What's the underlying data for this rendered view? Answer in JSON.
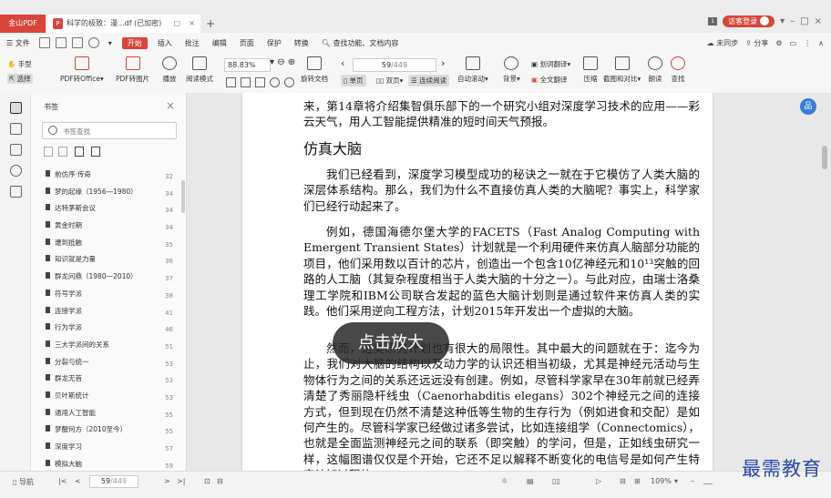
{
  "tabs": {
    "app": "金山PDF",
    "doc": "科学的极致：漫...df (已加密)",
    "new": "+"
  },
  "window": {
    "visitor": "访客登录",
    "badge": "1",
    "min": "–",
    "max": "□",
    "close": "×"
  },
  "menu": {
    "file": "文件",
    "items": [
      "开始",
      "插入",
      "批注",
      "编辑",
      "页面",
      "保护",
      "转换"
    ],
    "search": "查找功能、文档内容",
    "sync": "未同步",
    "share": "分享"
  },
  "toolbar": {
    "hand": "手型",
    "select": "选择",
    "pdf_to_office": "PDF转Office",
    "pdf_to_image": "PDF转图片",
    "play": "播放",
    "read_mode": "阅读模式",
    "zoom_value": "88.83%",
    "rotate": "旋转文档",
    "page_current": "59",
    "page_total": "/449",
    "single": "单页",
    "double": "双页",
    "continuous": "连续阅读",
    "auto_scroll": "自动滚动",
    "background": "背景",
    "translate_all": "全文翻译",
    "translate_word": "划词翻译",
    "compress": "压缩",
    "screenshot_compare": "截图和对比",
    "read_aloud": "朗读",
    "find": "查找"
  },
  "bookmarks": {
    "title": "书签",
    "search_placeholder": "书签查找",
    "items": [
      {
        "label": "前仿序·传奇",
        "page": "32"
      },
      {
        "label": "梦的起缘（1956—1980）",
        "page": "34"
      },
      {
        "label": "达特茅斯会议",
        "page": "34"
      },
      {
        "label": "黄金时期",
        "page": "34"
      },
      {
        "label": "遭到抵触",
        "page": "35"
      },
      {
        "label": "知识就是力量",
        "page": "36"
      },
      {
        "label": "群龙问鼎（1980—2010）",
        "page": "37"
      },
      {
        "label": "符号学派",
        "page": "38"
      },
      {
        "label": "连接学派",
        "page": "41"
      },
      {
        "label": "行为学派",
        "page": "46"
      },
      {
        "label": "三大学派间的关系",
        "page": "51"
      },
      {
        "label": "分裂与统一",
        "page": "53"
      },
      {
        "label": "群龙无首",
        "page": "53"
      },
      {
        "label": "贝叶斯统计",
        "page": "53"
      },
      {
        "label": "通用人工智能",
        "page": "55"
      },
      {
        "label": "梦醒何方（2010至今）",
        "page": "55"
      },
      {
        "label": "深度学习",
        "page": "57"
      },
      {
        "label": "模拟大脑",
        "page": "59"
      }
    ]
  },
  "document": {
    "para_top": "来，第14章将介绍集智俱乐部下的一个研究小组对深度学习技术的应用——彩云天气，用人工智能提供精准的短时间天气预报。",
    "heading": "仿真大脑",
    "para1": "我们已经看到，深度学习模型成功的秘诀之一就在于它模仿了人类大脑的深层体系结构。那么，我们为什么不直接仿真人类的大脑呢？事实上，科学家们已经行动起来了。",
    "para2": "例如，德国海德尔堡大学的FACETS（Fast Analog Computing with Emergent Transient States）计划就是一个利用硬件来仿真人脑部分功能的项目，他们采用数以百计的芯片，创造出一个包含10亿神经元和10¹³突触的回路的人工脑（其复杂程度相当于人类大脑的十分之一）。与此对应，由瑞士洛桑理工学院和IBM公司联合发起的蓝色大脑计划则是通过软件来仿真人类的实践。他们采用逆向工程方法，计划2015年开发出一个虚拟的大脑。",
    "para3": "然而，这类研究计划也有很大的局限性。其中最大的问题就在于：迄今为止，我们对大脑的结构以及动力学的认识还相当初级，尤其是神经元活动与生物体行为之间的关系还远远没有创建。例如，尽管科学家早在30年前就已经弄清楚了秀丽隐杆线虫（Caenorhabditis elegans）302个神经元之间的连接方式，但到现在仍然不清楚这种低等生物的生存行为（例如进食和交配）是如何产生的。尽管科学家已经做过诸多尝试，比如连接组学（Connectomics），也就是全面监测神经元之间的联系（即突触）的学问，但是，正如线虫研究一样，这幅图谱仅仅是个开始，它还不足以解释不断变化的电信号是如何产生特定认知过程的。",
    "zoom_overlay": "点击放大",
    "float_icon": "品"
  },
  "statusbar": {
    "nav": "导航",
    "page_current": "59",
    "page_total": "/449",
    "zoom": "109%",
    "zoom_minus": "–",
    "zoom_plus": "+"
  },
  "watermark": "最需教育"
}
